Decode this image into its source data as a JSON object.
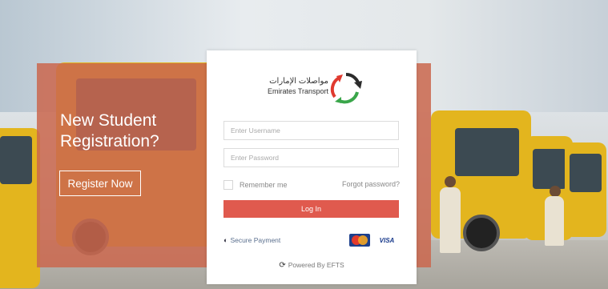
{
  "promo": {
    "title": "New Student Registration?",
    "register_label": "Register Now"
  },
  "brand": {
    "name_arabic": "مواصلات الإمارات",
    "name_english": "Emirates Transport",
    "logo_icon": "circular-arrows-logo"
  },
  "login": {
    "username_placeholder": "Enter Username",
    "password_placeholder": "Enter Password",
    "remember_label": "Remember me",
    "forgot_label": "Forgot password?",
    "submit_label": "Log In"
  },
  "footer": {
    "secure_label": "Secure Payment",
    "secure_icon": "shield-icon",
    "cards": [
      "mastercard-icon",
      "VISA"
    ],
    "powered_label": "Powered By EFTS"
  },
  "colors": {
    "accent": "#e05a4e",
    "promo_overlay": "#cb684e"
  }
}
